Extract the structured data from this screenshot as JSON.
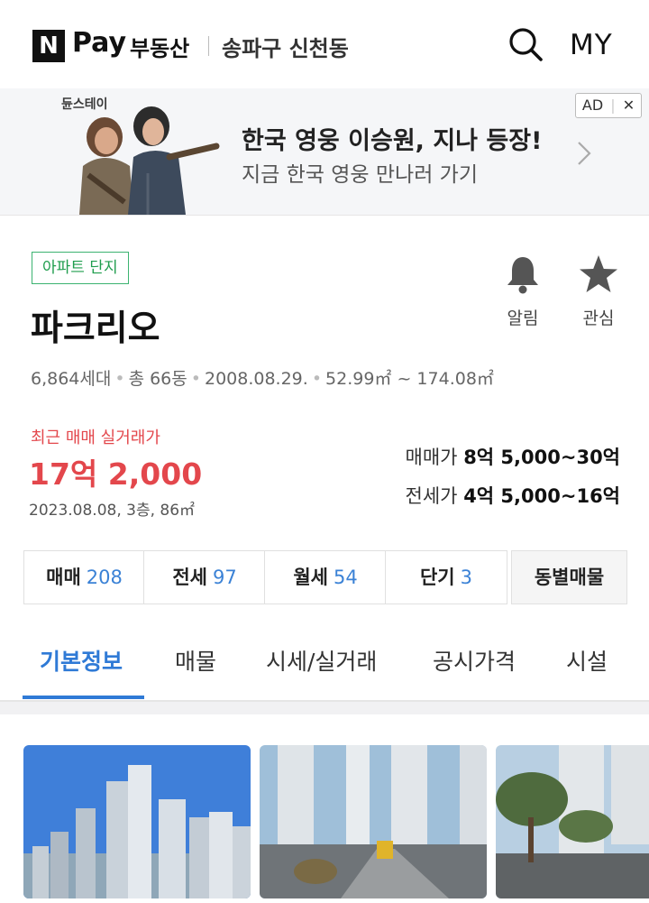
{
  "header": {
    "logo_mark": "N",
    "logo_pay": "Pay",
    "service_name": "부동산",
    "location": "송파구 신천동",
    "search_icon": "search-icon",
    "my_label": "MY"
  },
  "ad": {
    "game_logo": "듄스테이",
    "title": "한국 영웅 이승원, 지나 등장!",
    "subtitle": "지금 한국 영웅 만나러 가기",
    "badge_ad": "AD",
    "badge_close": "✕"
  },
  "complex": {
    "tag": "아파트 단지",
    "name": "파크리오",
    "alarm_label": "알림",
    "favorite_label": "관심",
    "households": "6,864세대",
    "buildings": "총 66동",
    "approval_date": "2008.08.29.",
    "area_range": "52.99㎡ ~ 174.08㎡",
    "recent_label": "최근 매매 실거래가",
    "recent_price": "17억 2,000",
    "recent_detail": "2023.08.08, 3층, 86㎡",
    "sale_label": "매매가",
    "sale_range": "8억 5,000~30억",
    "jeonse_label": "전세가",
    "jeonse_range": "4억 5,000~16억"
  },
  "listing_counts": [
    {
      "label": "매매",
      "count": "208"
    },
    {
      "label": "전세",
      "count": "97"
    },
    {
      "label": "월세",
      "count": "54"
    },
    {
      "label": "단기",
      "count": "3"
    }
  ],
  "by_dong_label": "동별매물",
  "tabs": [
    "기본정보",
    "매물",
    "시세/실거래",
    "공시가격",
    "시설"
  ],
  "colors": {
    "accent_blue": "#2f7ad6",
    "price_red": "#e3474c",
    "tag_green": "#1f9d4d"
  }
}
